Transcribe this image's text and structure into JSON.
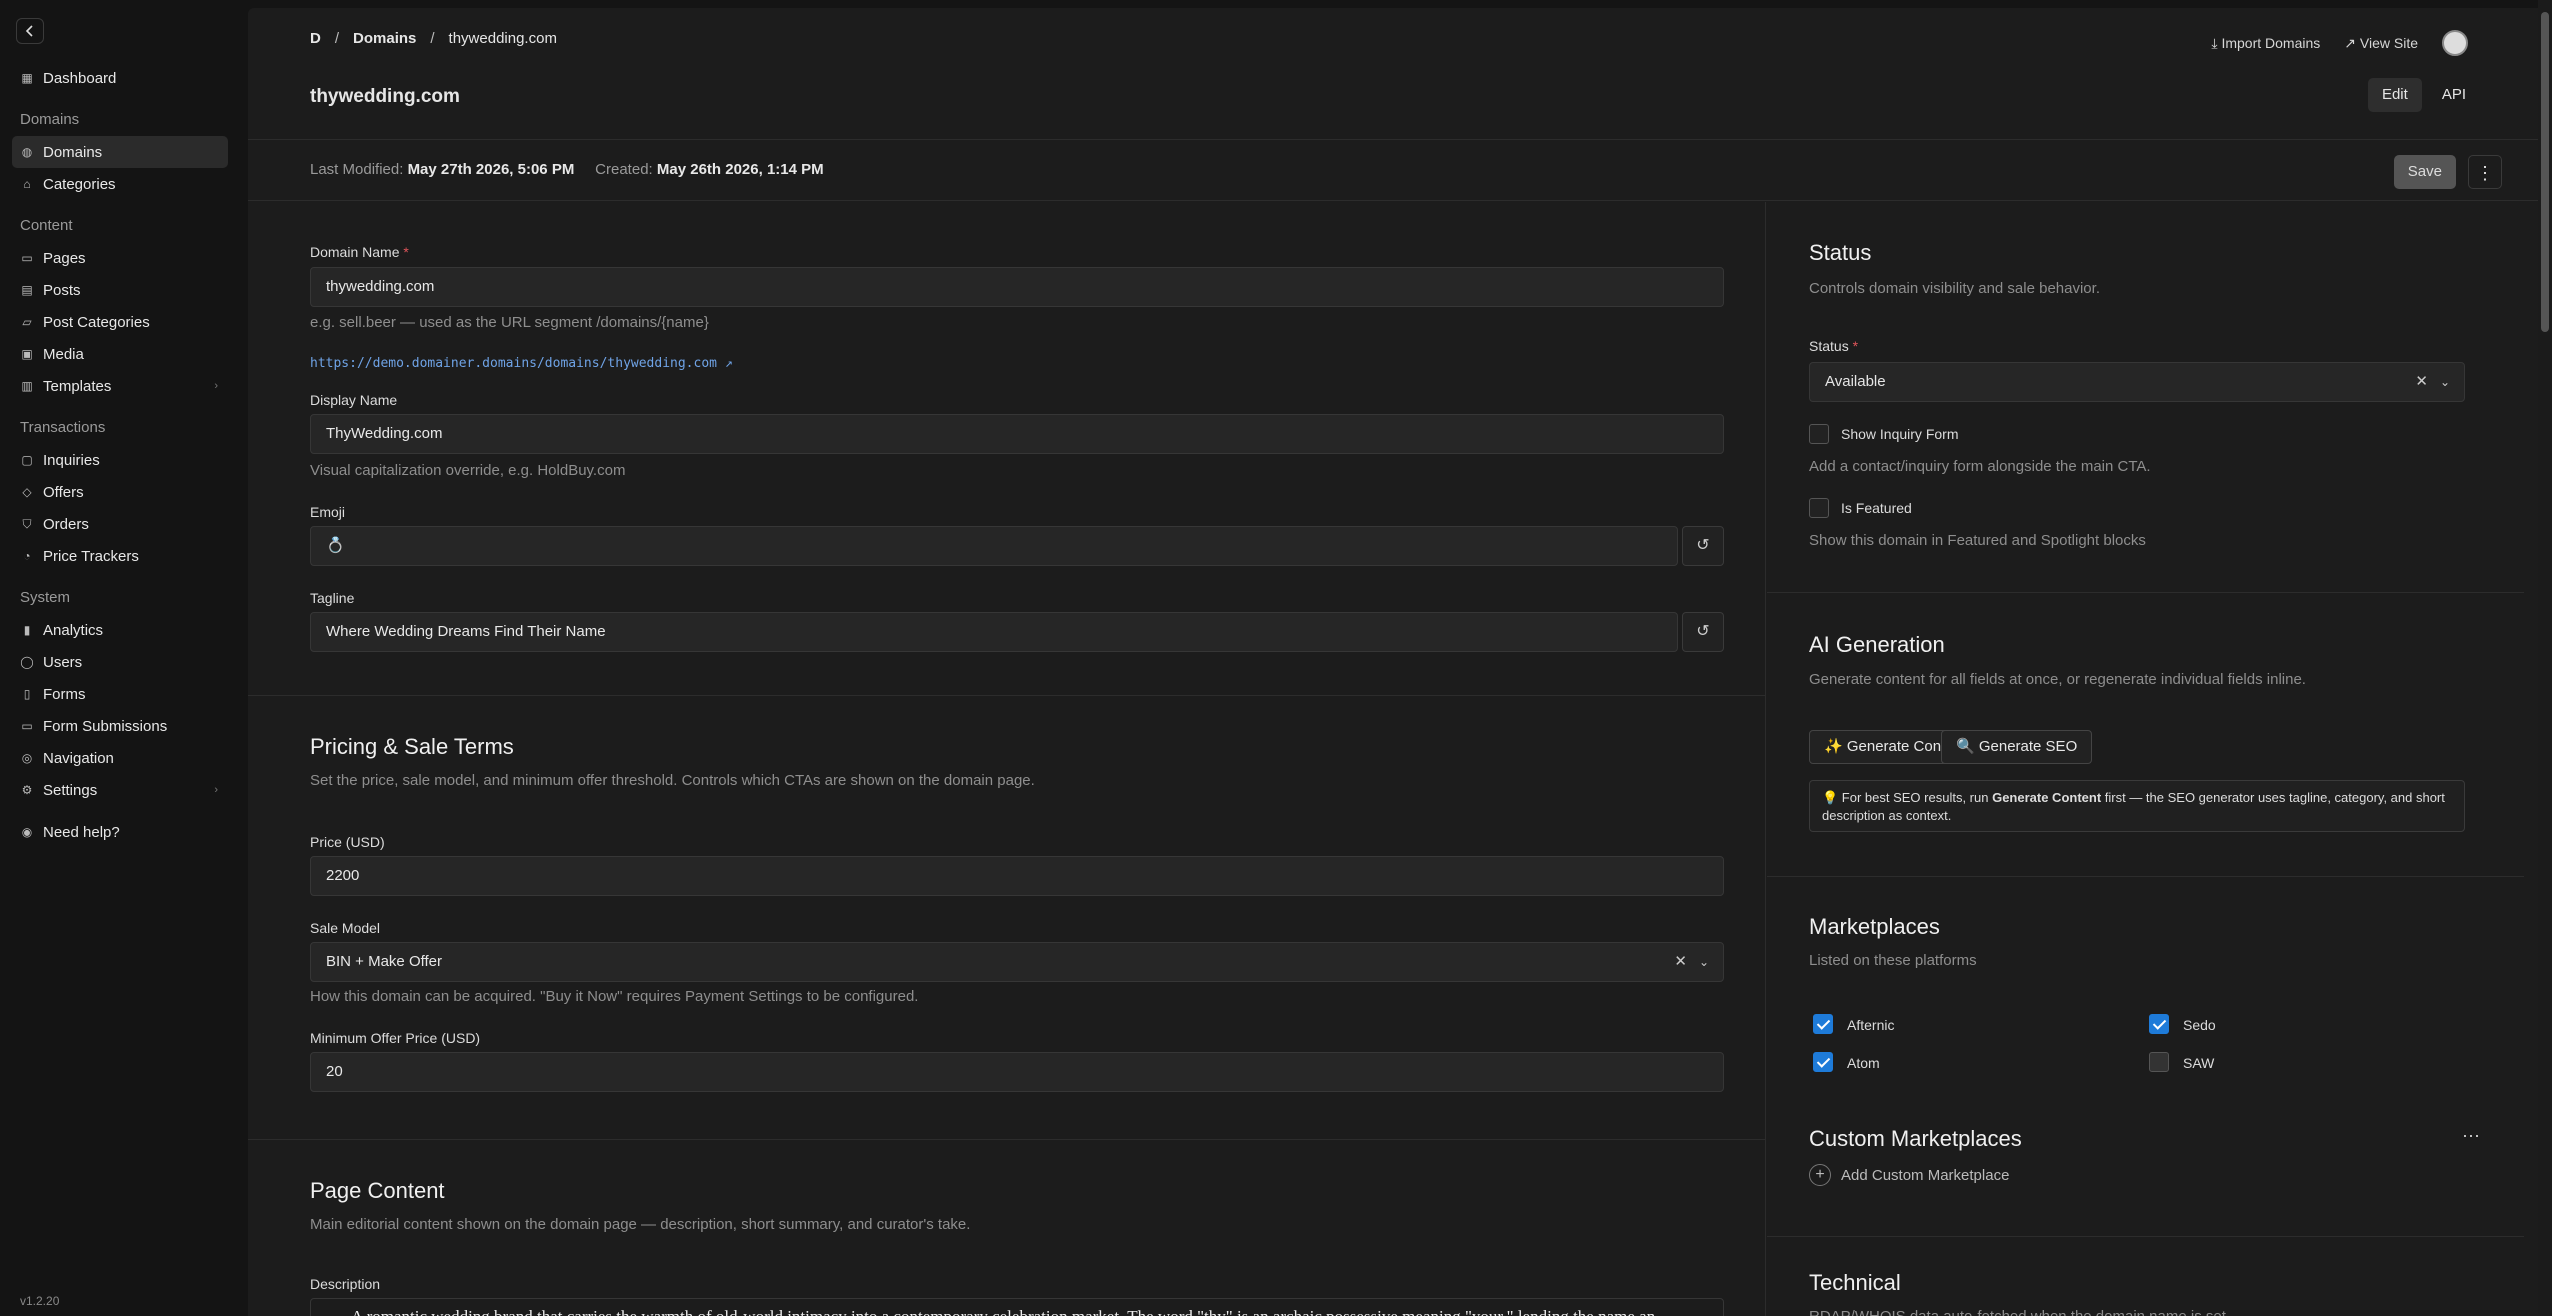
{
  "sidebar": {
    "version": "v1.2.20",
    "groups": [
      {
        "items": [
          {
            "label": "Dashboard",
            "icon": "grid-icon"
          }
        ]
      },
      {
        "title": "Domains",
        "items": [
          {
            "label": "Domains",
            "icon": "globe-icon",
            "active": true
          },
          {
            "label": "Categories",
            "icon": "tag-icon"
          }
        ]
      },
      {
        "title": "Content",
        "items": [
          {
            "label": "Pages",
            "icon": "page-icon"
          },
          {
            "label": "Posts",
            "icon": "post-icon"
          },
          {
            "label": "Post Categories",
            "icon": "folder-icon"
          },
          {
            "label": "Media",
            "icon": "image-icon"
          },
          {
            "label": "Templates",
            "icon": "template-icon",
            "chevron": true
          }
        ]
      },
      {
        "title": "Transactions",
        "items": [
          {
            "label": "Inquiries",
            "icon": "message-icon"
          },
          {
            "label": "Offers",
            "icon": "offer-icon"
          },
          {
            "label": "Orders",
            "icon": "cart-icon"
          },
          {
            "label": "Price Trackers",
            "icon": "bell-icon"
          }
        ]
      },
      {
        "title": "System",
        "items": [
          {
            "label": "Analytics",
            "icon": "chart-icon"
          },
          {
            "label": "Users",
            "icon": "user-icon"
          },
          {
            "label": "Forms",
            "icon": "form-icon"
          },
          {
            "label": "Form Submissions",
            "icon": "inbox-icon"
          },
          {
            "label": "Navigation",
            "icon": "compass-icon"
          },
          {
            "label": "Settings",
            "icon": "gear-icon",
            "chevron": true
          }
        ]
      },
      {
        "items": [
          {
            "label": "Need help?",
            "icon": "help-icon"
          }
        ]
      }
    ]
  },
  "header": {
    "breadcrumb": [
      "D",
      "Domains",
      "thywedding.com"
    ],
    "import_label": "Import Domains",
    "view_site_label": "View Site",
    "title": "thywedding.com",
    "tabs": [
      "Edit",
      "API"
    ]
  },
  "meta": {
    "modified_label": "Last Modified:",
    "modified_value": "May 27th 2026, 5:06 PM",
    "created_label": "Created:",
    "created_value": "May 26th 2026, 1:14 PM",
    "save_label": "Save"
  },
  "form": {
    "domain_name_label": "Domain Name",
    "domain_name_value": "thywedding.com",
    "domain_name_hint": "e.g. sell.beer — used as the URL segment /domains/{name}",
    "domain_url": "https://demo.domainer.domains/domains/thywedding.com",
    "display_name_label": "Display Name",
    "display_name_value": "ThyWedding.com",
    "display_name_hint": "Visual capitalization override, e.g. HoldBuy.com",
    "emoji_label": "Emoji",
    "emoji_value": "💍",
    "tagline_label": "Tagline",
    "tagline_value": "Where Wedding Dreams Find Their Name"
  },
  "pricing": {
    "title": "Pricing & Sale Terms",
    "subtitle": "Set the price, sale model, and minimum offer threshold. Controls which CTAs are shown on the domain page.",
    "price_label": "Price (USD)",
    "price_value": "2200",
    "sale_model_label": "Sale Model",
    "sale_model_value": "BIN + Make Offer",
    "sale_model_hint": "How this domain can be acquired. \"Buy it Now\" requires Payment Settings to be configured.",
    "min_offer_label": "Minimum Offer Price (USD)",
    "min_offer_value": "20"
  },
  "page_content": {
    "title": "Page Content",
    "subtitle": "Main editorial content shown on the domain page — description, short summary, and curator's take.",
    "description_label": "Description",
    "description_value": "A romantic wedding brand that carries the warmth of old-world intimacy into a contemporary celebration market. The word \"thy\" is an archaic possessive meaning \"your,\" lending the name an"
  },
  "status": {
    "title": "Status",
    "subtitle": "Controls domain visibility and sale behavior.",
    "status_label": "Status",
    "status_value": "Available",
    "inquiry_label": "Show Inquiry Form",
    "inquiry_hint": "Add a contact/inquiry form alongside the main CTA.",
    "featured_label": "Is Featured",
    "featured_hint": "Show this domain in Featured and Spotlight blocks"
  },
  "ai": {
    "title": "AI Generation",
    "subtitle": "Generate content for all fields at once, or regenerate individual fields inline.",
    "gen_content_label": "✨ Generate Content",
    "gen_seo_label": "🔍 Generate SEO",
    "tip_prefix": "💡 For best SEO results, run ",
    "tip_bold": "Generate Content",
    "tip_suffix": " first — the SEO generator uses tagline, category, and short description as context."
  },
  "marketplaces": {
    "title": "Marketplaces",
    "subtitle": "Listed on these platforms",
    "items": [
      {
        "label": "Afternic",
        "checked": true
      },
      {
        "label": "Sedo",
        "checked": true
      },
      {
        "label": "Atom",
        "checked": true
      },
      {
        "label": "SAW",
        "checked": false
      }
    ]
  },
  "custom_marketplaces": {
    "title": "Custom Marketplaces",
    "add_label": "Add Custom Marketplace"
  },
  "technical": {
    "title": "Technical",
    "subtitle": "RDAP/WHOIS data auto-fetched when the domain name is set."
  }
}
